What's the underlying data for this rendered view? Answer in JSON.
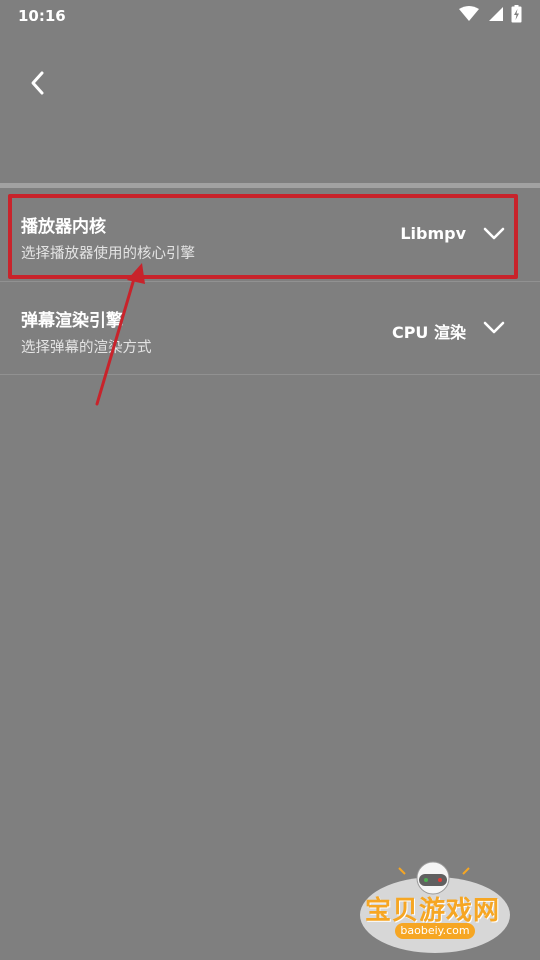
{
  "status_bar": {
    "time": "10:16",
    "icons": [
      "wifi-icon",
      "signal-icon",
      "battery-charging-icon"
    ]
  },
  "app_bar": {
    "back_icon": "chevron-left-icon"
  },
  "settings": [
    {
      "title": "播放器内核",
      "subtitle": "选择播放器使用的核心引擎",
      "value": "Libmpv",
      "icon": "chevron-down-icon"
    },
    {
      "title": "弹幕渲染引擎",
      "subtitle": "选择弹幕的渲染方式",
      "value": "CPU 渲染",
      "icon": "chevron-down-icon"
    }
  ],
  "annotation": {
    "color": "#c8232b"
  },
  "watermark": {
    "title": "宝贝游戏网",
    "url": "baobeiy.com",
    "color": "#f6a623"
  }
}
